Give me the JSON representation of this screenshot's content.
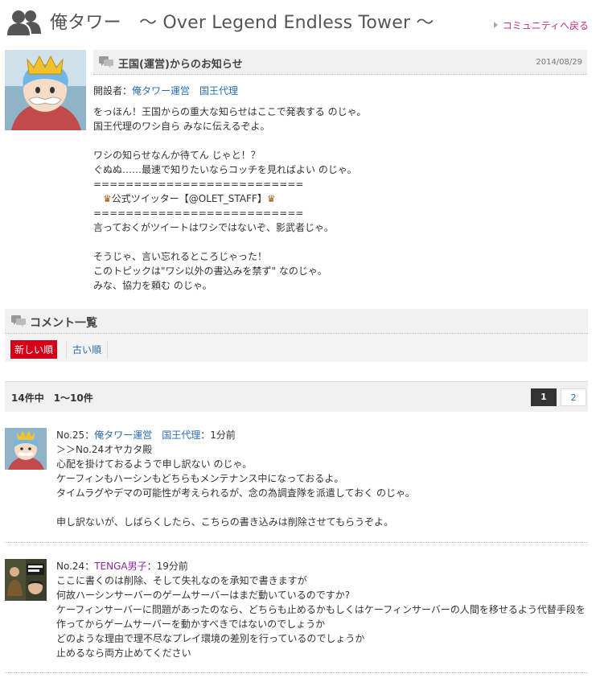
{
  "header": {
    "title": "俺タワー　～ Over Legend Endless Tower ～",
    "back_link": "コミュニティへ戻る"
  },
  "notice": {
    "title": "王国(運営)からのお知らせ",
    "date": "2014/08/29",
    "author_label": "開設者：",
    "author": "俺タワー運営　国王代理",
    "lines": [
      "をっほん！王国からの重大な知らせはここで発表する のじゃ。",
      "国王代理のワシ自ら みなに伝えるぞよ。",
      "",
      "ワシの知らせなんか待てん じゃと！？",
      "ぐぬぬ……最速で知りたいならコッチを見ればよい のじゃ。",
      "==========================",
      "公式ツイッター【@OLET_STAFF】",
      "==========================",
      "言っておくがツイートはワシではないぞ、影武者じゃ。",
      "",
      "そうじゃ、言い忘れるところじゃった！",
      "このトピックは\"ワシ以外の書込みを禁ず\" なのじゃ。",
      "みな、協力を頼む のじゃ。"
    ]
  },
  "comments_section": {
    "title": "コメント一覧",
    "sort_new": "新しい順",
    "sort_old": "古い順",
    "count": "14件中　1～10件",
    "pages": [
      "1",
      "2"
    ]
  },
  "comments": [
    {
      "number": "No.25：",
      "author": "俺タワー運営　国王代理",
      "time": "：1分前",
      "lines": [
        "＞＞No.24オヤカタ殿",
        "心配を掛けておるようで申し訳ない のじゃ。",
        "ケーフィンもハーシンもどちらもメンテナンス中になっておるよ。",
        "タイムラグやデマの可能性が考えられるが、念の為調査隊を派遣しておく のじゃ。",
        "",
        "申し訳ないが、しばらくしたら、こちらの書き込みは削除させてもらうぞよ。"
      ]
    },
    {
      "number": "No.24：",
      "author": "TENGA男子",
      "time": "：19分前",
      "lines": [
        "ここに書くのは削除、そして失礼なのを承知で書きますが",
        "何故ハーシンサーバーのゲームサーバーはまだ動いているのですか?",
        "ケーフィンサーバーに問題があったのなら、どちらも止めるかもしくはケーフィンサーバーの人間を移せるよう代替手段を",
        "作ってからゲームサーバーを動かすべきではないのでしょうか",
        "どのような理由で理不尽なプレイ環境の差別を行っているのでしょうか",
        "止めるなら両方止めてください"
      ]
    }
  ],
  "colors": {
    "accent_red": "#d4001a",
    "link_blue": "#2a6cad",
    "back_link": "#c03388"
  }
}
